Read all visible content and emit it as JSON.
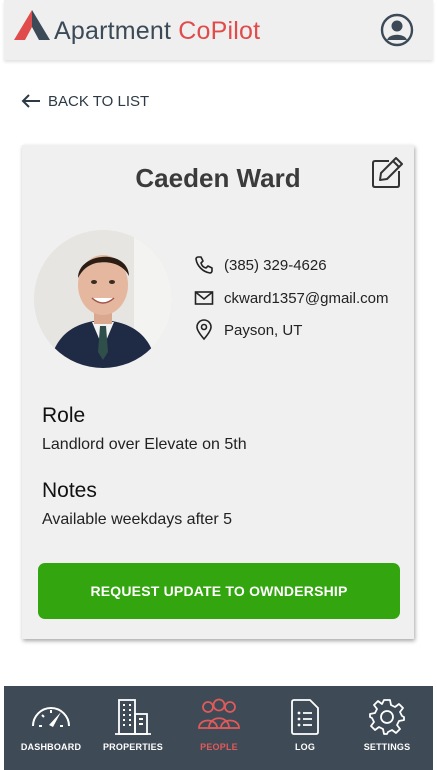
{
  "colors": {
    "brand_dark": "#3c4a57",
    "brand_accent": "#e04c4c",
    "nav_bg": "#3e4a55",
    "cta_green": "#33a60f",
    "card_bg": "#f0f0f0"
  },
  "header": {
    "title_part1": "Apartment ",
    "title_part2": "CoPilot",
    "account_icon": "user-circle-icon"
  },
  "back": {
    "label": "BACK TO LIST",
    "icon": "arrow-left-icon"
  },
  "profile": {
    "name": "Caeden Ward",
    "edit_icon": "edit-icon",
    "phone": "(385) 329-4626",
    "email": "ckward1357@gmail.com",
    "location": "Payson, UT",
    "role_title": "Role",
    "role_text": "Landlord over Elevate on 5th",
    "notes_title": "Notes",
    "notes_text": "Available weekdays after 5",
    "cta_label": "REQUEST UPDATE TO OWNDERSHIP"
  },
  "nav": {
    "items": [
      {
        "label": "DASHBOARD",
        "icon": "speedometer-icon"
      },
      {
        "label": "PROPERTIES",
        "icon": "buildings-icon"
      },
      {
        "label": "PEOPLE",
        "icon": "people-icon",
        "active": true
      },
      {
        "label": "LOG",
        "icon": "document-list-icon"
      },
      {
        "label": "SETTINGS",
        "icon": "gear-icon"
      }
    ]
  }
}
